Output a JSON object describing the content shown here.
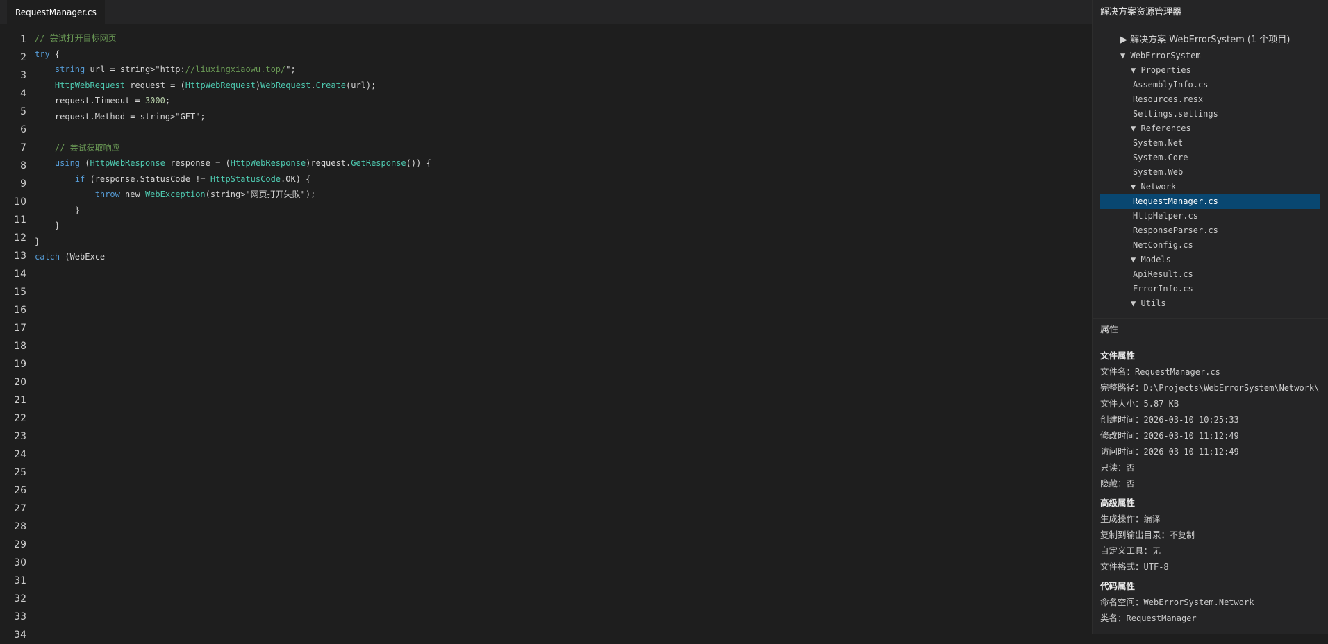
{
  "tab": {
    "title": "RequestManager.cs"
  },
  "editor": {
    "line_count": 34,
    "lines": [
      [
        {
          "t": "// 尝试打开目标网页",
          "c": "cm"
        }
      ],
      [
        {
          "t": "try",
          "c": "kw"
        },
        {
          "t": " {",
          "c": "pl"
        }
      ],
      [
        {
          "t": "    ",
          "c": "pl"
        },
        {
          "t": "string",
          "c": "kw"
        },
        {
          "t": " url = string>\"http:",
          "c": "pl"
        },
        {
          "t": "//liuxingxiaowu.top/",
          "c": "cm"
        },
        {
          "t": "\";",
          "c": "pl"
        }
      ],
      [
        {
          "t": "    ",
          "c": "pl"
        },
        {
          "t": "HttpWebRequest",
          "c": "ty"
        },
        {
          "t": " request = (",
          "c": "pl"
        },
        {
          "t": "HttpWebRequest",
          "c": "ty"
        },
        {
          "t": ")",
          "c": "pl"
        },
        {
          "t": "WebRequest",
          "c": "ty"
        },
        {
          "t": ".",
          "c": "pl"
        },
        {
          "t": "Create",
          "c": "fn"
        },
        {
          "t": "(url);",
          "c": "pl"
        }
      ],
      [
        {
          "t": "    request.Timeout = ",
          "c": "pl"
        },
        {
          "t": "3000",
          "c": "nu"
        },
        {
          "t": ";",
          "c": "pl"
        }
      ],
      [
        {
          "t": "    request.Method = string>\"GET\";",
          "c": "pl"
        }
      ],
      [],
      [
        {
          "t": "    ",
          "c": "pl"
        },
        {
          "t": "// 尝试获取响应",
          "c": "cm"
        }
      ],
      [
        {
          "t": "    ",
          "c": "pl"
        },
        {
          "t": "using",
          "c": "kw"
        },
        {
          "t": " (",
          "c": "pl"
        },
        {
          "t": "HttpWebResponse",
          "c": "ty"
        },
        {
          "t": " response = (",
          "c": "pl"
        },
        {
          "t": "HttpWebResponse",
          "c": "ty"
        },
        {
          "t": ")request.",
          "c": "pl"
        },
        {
          "t": "GetResponse",
          "c": "fn"
        },
        {
          "t": "()) {",
          "c": "pl"
        }
      ],
      [
        {
          "t": "        ",
          "c": "pl"
        },
        {
          "t": "if",
          "c": "kw"
        },
        {
          "t": " (response.StatusCode != ",
          "c": "pl"
        },
        {
          "t": "HttpStatusCode",
          "c": "ty"
        },
        {
          "t": ".OK) {",
          "c": "pl"
        }
      ],
      [
        {
          "t": "            ",
          "c": "pl"
        },
        {
          "t": "throw",
          "c": "kw"
        },
        {
          "t": " new ",
          "c": "pl"
        },
        {
          "t": "WebException",
          "c": "ty"
        },
        {
          "t": "(string>\"网页打开失败\");",
          "c": "pl"
        }
      ],
      [
        {
          "t": "        }",
          "c": "pl"
        }
      ],
      [
        {
          "t": "    }",
          "c": "pl"
        }
      ],
      [
        {
          "t": "}",
          "c": "pl"
        }
      ],
      [
        {
          "t": "catch",
          "c": "kw"
        },
        {
          "t": " (WebExce",
          "c": "pl"
        }
      ]
    ]
  },
  "solution_explorer": {
    "title": "解决方案资源管理器",
    "root": "▶ 解决方案 WebErrorSystem (1 个项目)",
    "items": [
      {
        "indent": 1,
        "arrow": "▼",
        "label": "WebErrorSystem"
      },
      {
        "indent": 2,
        "arrow": "▼",
        "label": "Properties"
      },
      {
        "indent": 3,
        "arrow": "",
        "label": "AssemblyInfo.cs"
      },
      {
        "indent": 3,
        "arrow": "",
        "label": "Resources.resx"
      },
      {
        "indent": 3,
        "arrow": "",
        "label": "Settings.settings"
      },
      {
        "indent": 2,
        "arrow": "▼",
        "label": "References"
      },
      {
        "indent": 3,
        "arrow": "",
        "label": "System.Net"
      },
      {
        "indent": 3,
        "arrow": "",
        "label": "System.Core"
      },
      {
        "indent": 3,
        "arrow": "",
        "label": "System.Web"
      },
      {
        "indent": 2,
        "arrow": "▼",
        "label": "Network"
      },
      {
        "indent": 3,
        "arrow": "",
        "label": "RequestManager.cs",
        "selected": true
      },
      {
        "indent": 3,
        "arrow": "",
        "label": "HttpHelper.cs"
      },
      {
        "indent": 3,
        "arrow": "",
        "label": "ResponseParser.cs"
      },
      {
        "indent": 3,
        "arrow": "",
        "label": "NetConfig.cs"
      },
      {
        "indent": 2,
        "arrow": "▼",
        "label": "Models"
      },
      {
        "indent": 3,
        "arrow": "",
        "label": "ApiResult.cs"
      },
      {
        "indent": 3,
        "arrow": "",
        "label": "ErrorInfo.cs"
      },
      {
        "indent": 2,
        "arrow": "▼",
        "label": "Utils"
      }
    ]
  },
  "properties": {
    "title": "属性",
    "sections": [
      {
        "heading": "文件属性",
        "rows": [
          {
            "k": "文件名：",
            "v": "RequestManager.cs"
          },
          {
            "k": "完整路径：",
            "v": "D:\\Projects\\WebErrorSystem\\Network\\"
          },
          {
            "k": "文件大小：",
            "v": "5.87 KB"
          },
          {
            "k": "创建时间：",
            "v": "2026-03-10 10:25:33"
          },
          {
            "k": "修改时间：",
            "v": "2026-03-10 11:12:49"
          },
          {
            "k": "访问时间：",
            "v": "2026-03-10 11:12:49"
          },
          {
            "k": "只读：",
            "v": "否"
          },
          {
            "k": "隐藏：",
            "v": "否"
          }
        ]
      },
      {
        "heading": "高级属性",
        "rows": [
          {
            "k": "生成操作：",
            "v": "编译"
          },
          {
            "k": "复制到输出目录：",
            "v": "不复制"
          },
          {
            "k": "自定义工具：",
            "v": "无"
          },
          {
            "k": "文件格式：",
            "v": "UTF-8"
          }
        ]
      },
      {
        "heading": "代码属性",
        "rows": [
          {
            "k": "命名空间：",
            "v": "WebErrorSystem.Network"
          },
          {
            "k": "类名：",
            "v": "RequestManager"
          }
        ]
      }
    ]
  },
  "colors": {
    "background": "#1e1e1e",
    "panel": "#252526",
    "selection": "#094771",
    "keyword": "#569cd6",
    "type": "#4ec9b0",
    "comment": "#6a9955",
    "number": "#b5cea8"
  }
}
